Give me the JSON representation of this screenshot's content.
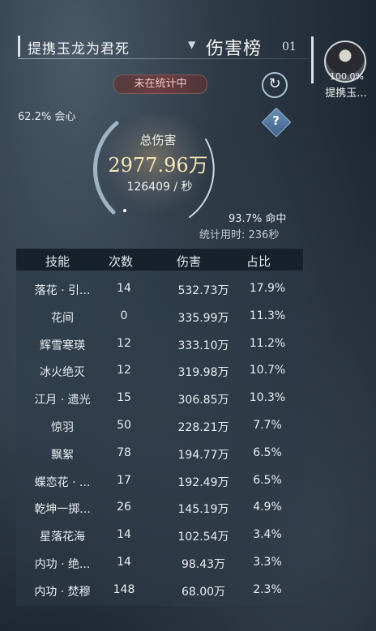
{
  "header": {
    "player_name": "提携玉龙为君死",
    "dropdown_icon": "triangle-down-icon",
    "board_title": "伤害榜",
    "page_number": "01"
  },
  "side_player": {
    "percent": "100.0%",
    "name": "提携玉..."
  },
  "status": {
    "label": "未在统计中",
    "refresh_icon": "refresh-icon",
    "help_icon": "question-icon"
  },
  "stats": {
    "crit": "62.2% 会心",
    "total_label": "总伤害",
    "total_value": "2977.96万",
    "dps": "126409 / 秒",
    "hit": "93.7% 命中",
    "elapsed": "统计用时: 236秒"
  },
  "table": {
    "headers": [
      "技能",
      "次数",
      "伤害",
      "占比"
    ],
    "rows": [
      {
        "skill": "落花 · 引...",
        "count": "14",
        "damage": "532.73万",
        "pct": "17.9%"
      },
      {
        "skill": "花间",
        "count": "0",
        "damage": "335.99万",
        "pct": "11.3%"
      },
      {
        "skill": "辉雪寒瑛",
        "count": "12",
        "damage": "333.10万",
        "pct": "11.2%"
      },
      {
        "skill": "冰火绝灭",
        "count": "12",
        "damage": "319.98万",
        "pct": "10.7%"
      },
      {
        "skill": "江月 · 遗光",
        "count": "15",
        "damage": "306.85万",
        "pct": "10.3%"
      },
      {
        "skill": "惊羽",
        "count": "50",
        "damage": "228.21万",
        "pct": "7.7%"
      },
      {
        "skill": "飘絮",
        "count": "78",
        "damage": "194.77万",
        "pct": "6.5%"
      },
      {
        "skill": "蝶恋花 · ...",
        "count": "17",
        "damage": "192.49万",
        "pct": "6.5%"
      },
      {
        "skill": "乾坤一掷...",
        "count": "26",
        "damage": "145.19万",
        "pct": "4.9%"
      },
      {
        "skill": "星落花海",
        "count": "14",
        "damage": "102.54万",
        "pct": "3.4%"
      },
      {
        "skill": "内功 · 绝...",
        "count": "14",
        "damage": "98.43万",
        "pct": "3.3%"
      },
      {
        "skill": "内功 · 焚穆",
        "count": "148",
        "damage": "68.00万",
        "pct": "2.3%"
      }
    ]
  }
}
